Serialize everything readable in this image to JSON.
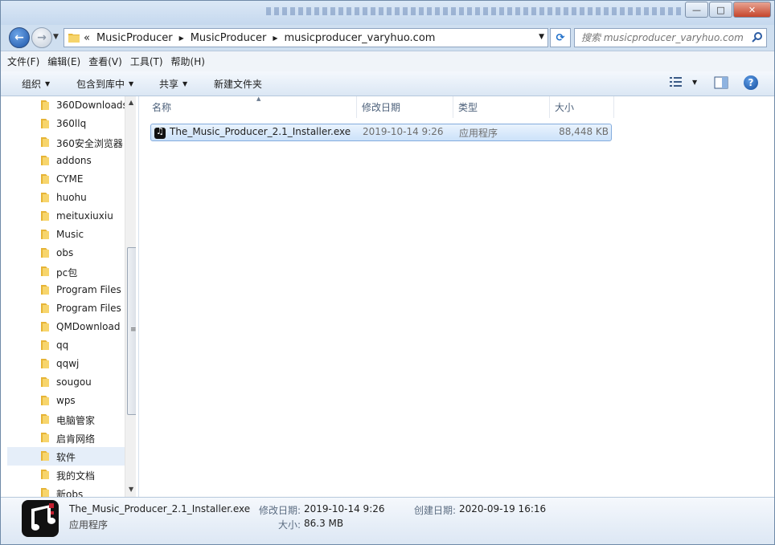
{
  "window": {
    "buttons": {
      "minimize": "—",
      "maximize": "□",
      "close": "✕"
    }
  },
  "address": {
    "overflow": "«",
    "crumbs": [
      "MusicProducer",
      "MusicProducer",
      "musicproducer_varyhuo.com"
    ],
    "search_placeholder": "搜索 musicproducer_varyhuo.com"
  },
  "menu": [
    "文件(F)",
    "编辑(E)",
    "查看(V)",
    "工具(T)",
    "帮助(H)"
  ],
  "toolbar": {
    "organize": "组织",
    "include": "包含到库中",
    "share": "共享",
    "new_folder": "新建文件夹"
  },
  "tree": [
    "360Downloads",
    "360llq",
    "360安全浏览器",
    "addons",
    "CYME",
    "huohu",
    "meituxiuxiu",
    "Music",
    "obs",
    "pc包",
    "Program Files",
    "Program Files",
    "QMDownload",
    "qq",
    "qqwj",
    "sougou",
    "wps",
    "电脑管家",
    "启肯网络",
    "软件",
    "我的文档",
    "新obs"
  ],
  "columns": {
    "name": "名称",
    "modified": "修改日期",
    "type": "类型",
    "size": "大小"
  },
  "files": [
    {
      "name": "The_Music_Producer_2.1_Installer.exe",
      "modified": "2019-10-14 9:26",
      "type": "应用程序",
      "size": "88,448 KB"
    }
  ],
  "details": {
    "name": "The_Music_Producer_2.1_Installer.exe",
    "type": "应用程序",
    "modified_label": "修改日期:",
    "modified": "2019-10-14 9:26",
    "created_label": "创建日期:",
    "created": "2020-09-19 16:16",
    "size_label": "大小:",
    "size": "86.3 MB"
  }
}
